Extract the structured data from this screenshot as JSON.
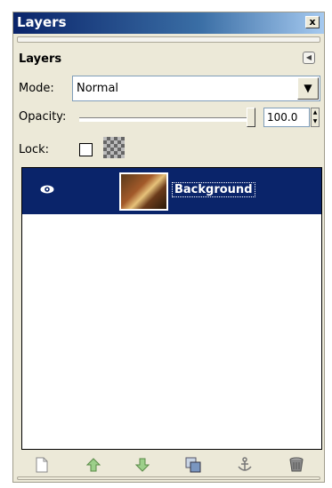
{
  "window": {
    "title": "Layers",
    "close_label": "x"
  },
  "panel": {
    "title": "Layers"
  },
  "mode": {
    "label": "Mode:",
    "value": "Normal"
  },
  "opacity": {
    "label": "Opacity:",
    "value": "100.0",
    "level": 1.0
  },
  "lock": {
    "label": "Lock:"
  },
  "layers": [
    {
      "name": "Background",
      "visible": true,
      "selected": true
    }
  ],
  "icons": {
    "close": "close-icon",
    "menu": "tab-menu-icon",
    "eye": "eye-icon",
    "new": "new-layer-icon",
    "raise": "raise-layer-icon",
    "lower": "lower-layer-icon",
    "duplicate": "duplicate-layer-icon",
    "anchor": "anchor-layer-icon",
    "delete": "delete-layer-icon"
  },
  "colors": {
    "title_bar": "#0a246a",
    "selection": "#0a246a",
    "panel_bg": "#ece9d8"
  }
}
